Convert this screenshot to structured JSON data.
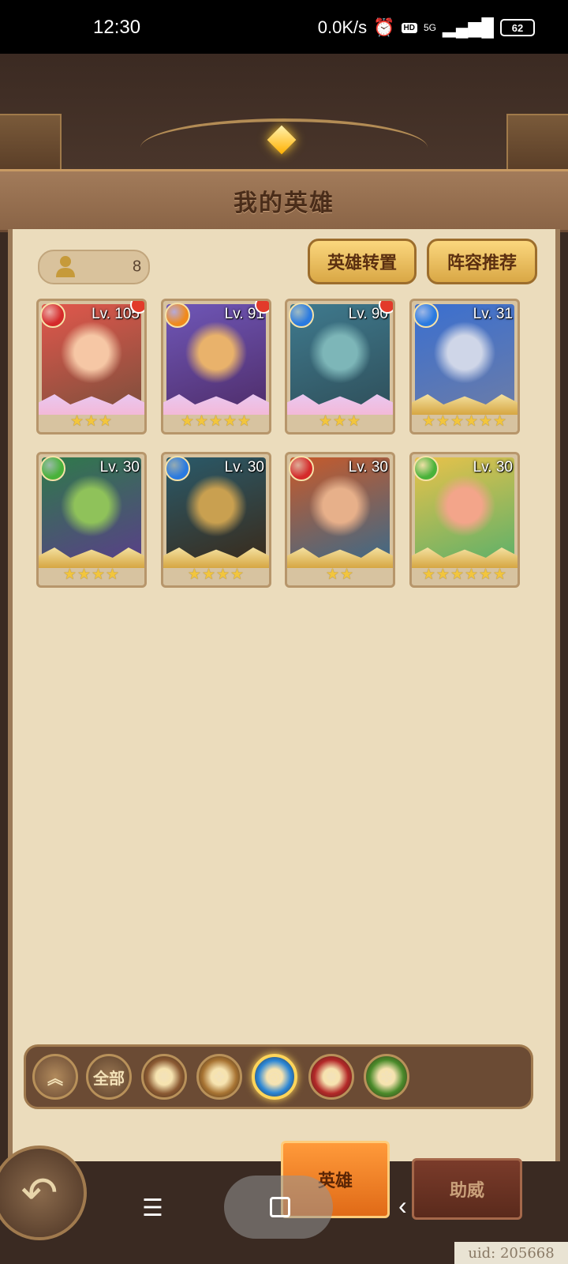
{
  "status_bar": {
    "time": "12:30",
    "net_speed": "0.0K/s",
    "alarm_icon": "alarm-icon",
    "hd_label": "HD",
    "signal_label": "5G",
    "battery": "62"
  },
  "header": {
    "title": "我的英雄"
  },
  "hero_count": "8",
  "buttons": {
    "transfer": "英雄转置",
    "lineup": "阵容推荐"
  },
  "heroes": [
    {
      "level": "Lv. 105",
      "element": "fire",
      "element_color": "#d52a2a",
      "stars": "★★★",
      "badge": true,
      "frame": "pink",
      "art": [
        "#e2574c",
        "#f6c7a5",
        "#7d4f3c"
      ]
    },
    {
      "level": "Lv. 91",
      "element": "light",
      "element_color": "#f08a1c",
      "stars": "★★★★★",
      "badge": true,
      "frame": "pink",
      "art": [
        "#6f57b8",
        "#e9b26b",
        "#4f2d6a"
      ]
    },
    {
      "level": "Lv. 90",
      "element": "water",
      "element_color": "#2a7ae0",
      "stars": "★★★",
      "badge": true,
      "frame": "pink",
      "art": [
        "#3f7a8e",
        "#7db6b8",
        "#2f4f5a"
      ]
    },
    {
      "level": "Lv. 31",
      "element": "water",
      "element_color": "#2a7ae0",
      "stars": "★★★★★★",
      "badge": false,
      "frame": "gold",
      "art": [
        "#3a6fd0",
        "#cfd6e8",
        "#6b7ca8"
      ]
    },
    {
      "level": "Lv. 30",
      "element": "nature",
      "element_color": "#49b23a",
      "stars": "★★★★",
      "badge": false,
      "frame": "gold",
      "art": [
        "#2f7a4a",
        "#8fc25a",
        "#5a3e8a"
      ]
    },
    {
      "level": "Lv. 30",
      "element": "water",
      "element_color": "#2a7ae0",
      "stars": "★★★★",
      "badge": false,
      "frame": "gold",
      "art": [
        "#2a5a6a",
        "#c9a050",
        "#3a2a1a"
      ]
    },
    {
      "level": "Lv. 30",
      "element": "fire",
      "element_color": "#d52a2a",
      "stars": "★★",
      "badge": false,
      "frame": "gold",
      "art": [
        "#c85a2a",
        "#e7b08a",
        "#3a6a8a"
      ]
    },
    {
      "level": "Lv. 30",
      "element": "nature",
      "element_color": "#49b23a",
      "stars": "★★★★★★",
      "badge": false,
      "frame": "gold",
      "art": [
        "#e9c24a",
        "#f3a58a",
        "#5ab06a"
      ]
    }
  ],
  "filters": {
    "all_label": "全部",
    "colors": [
      "#8b5a33",
      "#a87433",
      "#2a86d6",
      "#b32828",
      "#4a8a2a"
    ]
  },
  "tabs": {
    "hero": "英雄",
    "assist": "助威"
  },
  "uid": "uid: 205668"
}
